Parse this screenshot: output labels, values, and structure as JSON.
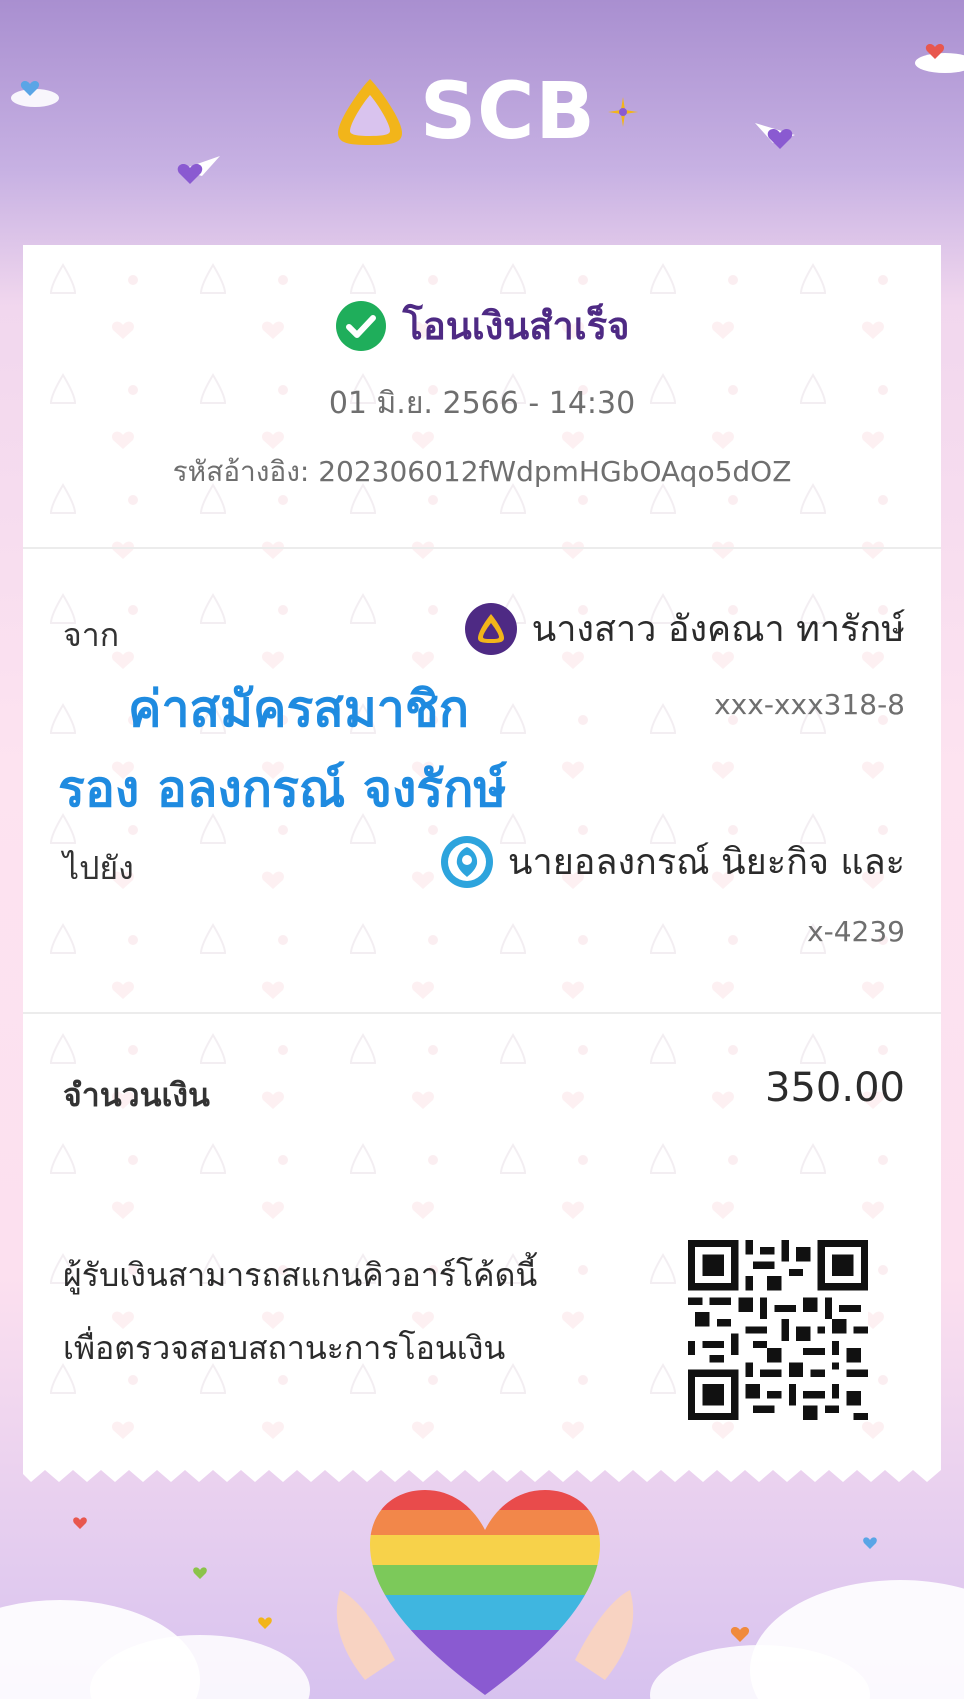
{
  "brand": {
    "name": "SCB"
  },
  "status": {
    "title": "โอนเงินสำเร็จ"
  },
  "datetime": "01 มิ.ย. 2566 - 14:30",
  "reference": {
    "label": "รหัสอ้างอิง:",
    "value": "202306012fWdpmHGbOAqo5dOZ"
  },
  "from": {
    "label": "จาก",
    "name": "นางสาว อังคณา ทารักษ์",
    "account": "xxx-xxx318-8"
  },
  "memo": {
    "line1": "ค่าสมัครสมาชิก",
    "line2": "รอง อลงกรณ์ จงรักษ์"
  },
  "to": {
    "label": "ไปยัง",
    "name": "นายอลงกรณ์ นิยะกิจ และ",
    "account": "x-4239"
  },
  "amount": {
    "label": "จำนวนเงิน",
    "value": "350.00"
  },
  "qr_note": {
    "line1": "ผู้รับเงินสามารถสแกนคิวอาร์โค้ดนี้",
    "line2": "เพื่อตรวจสอบสถานะการโอนเงิน"
  },
  "colors": {
    "brand_purple": "#4e2a84",
    "success_green": "#1fae5b",
    "memo_blue": "#1f8be0",
    "scb_gold": "#f2b51a"
  }
}
